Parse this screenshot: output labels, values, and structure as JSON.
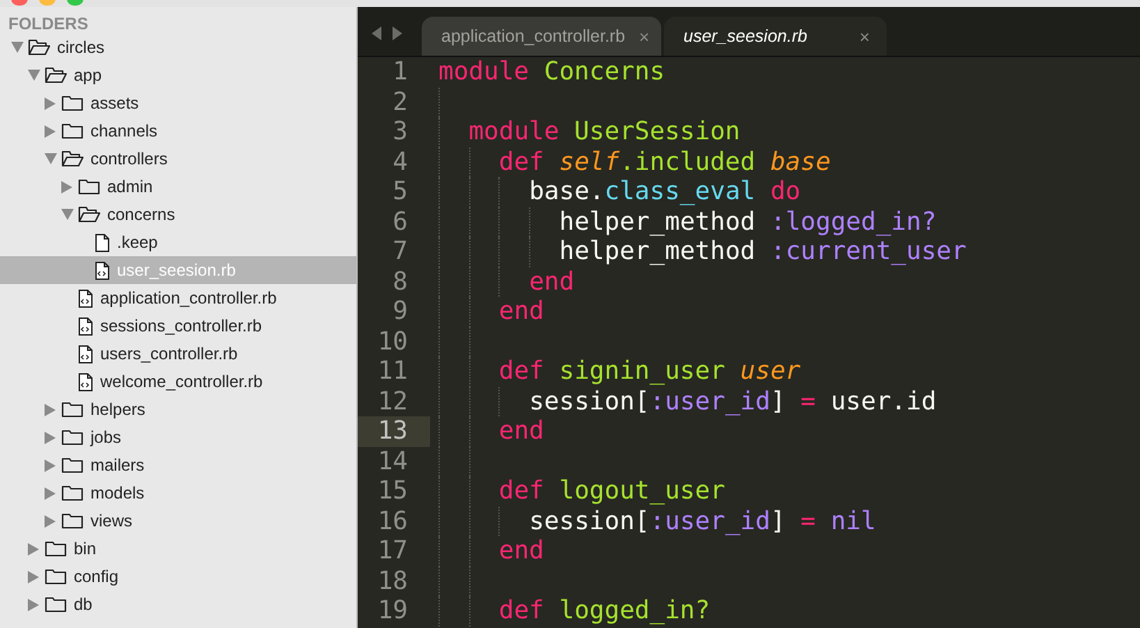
{
  "sidebar": {
    "header": "FOLDERS",
    "tree": [
      {
        "name": "circles",
        "kind": "folder",
        "expanded": true,
        "selected": false,
        "children": [
          {
            "name": "app",
            "kind": "folder",
            "expanded": true,
            "selected": false,
            "children": [
              {
                "name": "assets",
                "kind": "folder",
                "expanded": false,
                "selected": false
              },
              {
                "name": "channels",
                "kind": "folder",
                "expanded": false,
                "selected": false
              },
              {
                "name": "controllers",
                "kind": "folder",
                "expanded": true,
                "selected": false,
                "children": [
                  {
                    "name": "admin",
                    "kind": "folder",
                    "expanded": false,
                    "selected": false
                  },
                  {
                    "name": "concerns",
                    "kind": "folder",
                    "expanded": true,
                    "selected": false,
                    "children": [
                      {
                        "name": ".keep",
                        "kind": "file",
                        "selected": false
                      },
                      {
                        "name": "user_seesion.rb",
                        "kind": "code_file",
                        "selected": true
                      }
                    ]
                  },
                  {
                    "name": "application_controller.rb",
                    "kind": "code_file",
                    "selected": false
                  },
                  {
                    "name": "sessions_controller.rb",
                    "kind": "code_file",
                    "selected": false
                  },
                  {
                    "name": "users_controller.rb",
                    "kind": "code_file",
                    "selected": false
                  },
                  {
                    "name": "welcome_controller.rb",
                    "kind": "code_file",
                    "selected": false
                  }
                ]
              },
              {
                "name": "helpers",
                "kind": "folder",
                "expanded": false,
                "selected": false
              },
              {
                "name": "jobs",
                "kind": "folder",
                "expanded": false,
                "selected": false
              },
              {
                "name": "mailers",
                "kind": "folder",
                "expanded": false,
                "selected": false
              },
              {
                "name": "models",
                "kind": "folder",
                "expanded": false,
                "selected": false
              },
              {
                "name": "views",
                "kind": "folder",
                "expanded": false,
                "selected": false
              }
            ]
          },
          {
            "name": "bin",
            "kind": "folder",
            "expanded": false,
            "selected": false
          },
          {
            "name": "config",
            "kind": "folder",
            "expanded": false,
            "selected": false
          },
          {
            "name": "db",
            "kind": "folder",
            "expanded": false,
            "selected": false
          }
        ]
      }
    ]
  },
  "tabs": [
    {
      "label": "application_controller.rb",
      "close": "×",
      "selected": false
    },
    {
      "label": "user_seesion.rb",
      "close": "×",
      "selected": true
    }
  ],
  "editor": {
    "lines": [
      {
        "number": "1",
        "current": false,
        "tokens": [
          {
            "kind": "keyword",
            "text": "module"
          },
          {
            "kind": "entity",
            "text": " Concerns"
          }
        ],
        "children": [
          {
            "number": "2",
            "current": false
          },
          {
            "number": "3",
            "current": false,
            "tokens": [
              {
                "kind": "keyword",
                "text": "module"
              },
              {
                "kind": "entity",
                "text": " UserSession"
              }
            ],
            "children": [
              {
                "number": "4",
                "current": false,
                "tokens": [
                  {
                    "kind": "keyword",
                    "text": "def"
                  },
                  {
                    "kind": "param",
                    "text": " self"
                  },
                  {
                    "kind": "entity",
                    "text": ".included"
                  },
                  {
                    "kind": "param",
                    "text": " base"
                  }
                ],
                "children": [
                  {
                    "number": "5",
                    "current": false,
                    "tokens": [
                      {
                        "kind": "plain",
                        "text": "base."
                      },
                      {
                        "kind": "support",
                        "text": "class_eval"
                      },
                      {
                        "kind": "keyword",
                        "text": " do"
                      }
                    ],
                    "children": [
                      {
                        "number": "6",
                        "current": false,
                        "tokens": [
                          {
                            "kind": "plain",
                            "text": "helper_method"
                          },
                          {
                            "kind": "symbol",
                            "text": " :logged_in?"
                          }
                        ]
                      },
                      {
                        "number": "7",
                        "current": false,
                        "tokens": [
                          {
                            "kind": "plain",
                            "text": "helper_method"
                          },
                          {
                            "kind": "symbol",
                            "text": " :current_user"
                          }
                        ]
                      }
                    ]
                  },
                  {
                    "number": "8",
                    "current": false,
                    "tokens": [
                      {
                        "kind": "keyword",
                        "text": "end"
                      }
                    ]
                  }
                ]
              },
              {
                "number": "9",
                "current": false,
                "tokens": [
                  {
                    "kind": "keyword",
                    "text": "end"
                  }
                ]
              },
              {
                "number": "10",
                "current": false
              },
              {
                "number": "11",
                "current": false,
                "tokens": [
                  {
                    "kind": "keyword",
                    "text": "def"
                  },
                  {
                    "kind": "entity",
                    "text": " signin_user"
                  },
                  {
                    "kind": "param",
                    "text": " user"
                  }
                ],
                "children": [
                  {
                    "number": "12",
                    "current": false,
                    "tokens": [
                      {
                        "kind": "plain",
                        "text": "session["
                      },
                      {
                        "kind": "symbol",
                        "text": ":user_id"
                      },
                      {
                        "kind": "plain",
                        "text": "]"
                      },
                      {
                        "kind": "keyword",
                        "text": " ="
                      },
                      {
                        "kind": "plain",
                        "text": " user.id"
                      }
                    ]
                  }
                ]
              },
              {
                "number": "13",
                "current": true,
                "tokens": [
                  {
                    "kind": "keyword",
                    "text": "end"
                  }
                ]
              },
              {
                "number": "14",
                "current": false
              },
              {
                "number": "15",
                "current": false,
                "tokens": [
                  {
                    "kind": "keyword",
                    "text": "def"
                  },
                  {
                    "kind": "entity",
                    "text": " logout_user"
                  }
                ],
                "children": [
                  {
                    "number": "16",
                    "current": false,
                    "tokens": [
                      {
                        "kind": "plain",
                        "text": "session["
                      },
                      {
                        "kind": "symbol",
                        "text": ":user_id"
                      },
                      {
                        "kind": "plain",
                        "text": "]"
                      },
                      {
                        "kind": "keyword",
                        "text": " ="
                      },
                      {
                        "kind": "symbol",
                        "text": " nil"
                      }
                    ]
                  }
                ]
              },
              {
                "number": "17",
                "current": false,
                "tokens": [
                  {
                    "kind": "keyword",
                    "text": "end"
                  }
                ]
              },
              {
                "number": "18",
                "current": false
              },
              {
                "number": "19",
                "current": false,
                "tokens": [
                  {
                    "kind": "keyword",
                    "text": "def"
                  },
                  {
                    "kind": "entity",
                    "text": " logged_in?"
                  }
                ]
              }
            ]
          }
        ]
      }
    ]
  }
}
